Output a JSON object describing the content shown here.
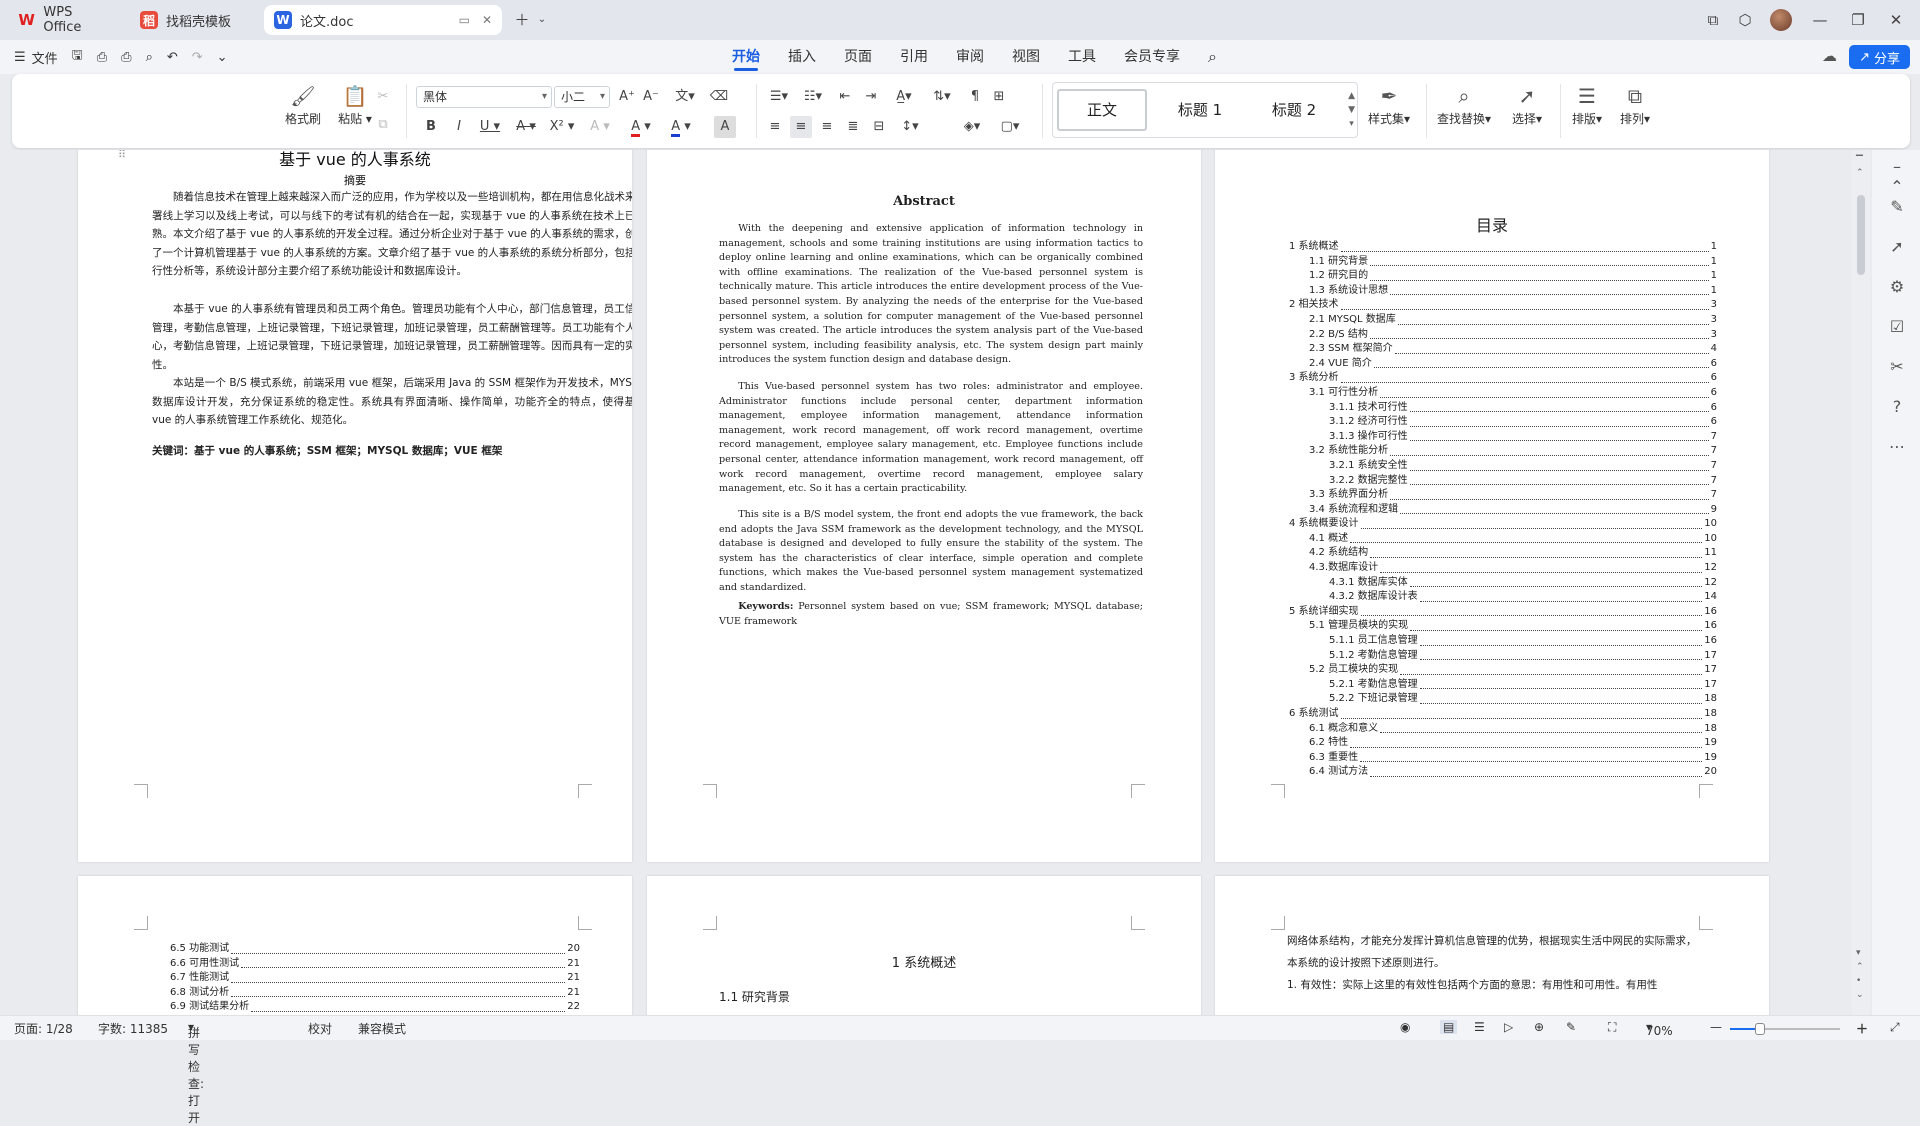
{
  "tabs": [
    {
      "label": "WPS Office",
      "icon": "wps-logo-icon"
    },
    {
      "label": "找稻壳模板",
      "icon": "docer-icon"
    },
    {
      "label": "论文.doc",
      "icon": "word-doc-icon"
    }
  ],
  "menu": {
    "file": "文件"
  },
  "ribbon_tabs": [
    "开始",
    "插入",
    "页面",
    "引用",
    "审阅",
    "视图",
    "工具",
    "会员专享"
  ],
  "share": "分享",
  "toolbar": {
    "format_painter": "格式刷",
    "paste": "粘贴",
    "font_name": "黑体",
    "font_size": "小二",
    "styles": [
      "正文",
      "标题 1",
      "标题 2"
    ],
    "styles_set": "样式集",
    "find_replace": "查找替换",
    "select": "选择",
    "layout": "排版",
    "arrange": "排列"
  },
  "page1": {
    "title": "基于 vue 的人事系统",
    "abstract_heading": "摘要",
    "paragraphs": [
      "随着信息技术在管理上越来越深入而广泛的应用，作为学校以及一些培训机构，都在用信息化战术来部署线上学习以及线上考试，可以与线下的考试有机的结合在一起，实现基于 vue 的人事系统在技术上已成熟。本文介绍了基于 vue 的人事系统的开发全过程。通过分析企业对于基于 vue 的人事系统的需求，创建了一个计算机管理基于 vue 的人事系统的方案。文章介绍了基于 vue 的人事系统的系统分析部分，包括可行性分析等，系统设计部分主要介绍了系统功能设计和数据库设计。",
      "本基于 vue 的人事系统有管理员和员工两个角色。管理员功能有个人中心，部门信息管理，员工信息管理，考勤信息管理，上班记录管理，下班记录管理，加班记录管理，员工薪酬管理等。员工功能有个人中心，考勤信息管理，上班记录管理，下班记录管理，加班记录管理，员工薪酬管理等。因而具有一定的实用性。",
      "本站是一个 B/S 模式系统，前端采用 vue 框架，后端采用 Java 的 SSM 框架作为开发技术，MYSQL 数据库设计开发，充分保证系统的稳定性。系统具有界面清晰、操作简单，功能齐全的特点，使得基于 vue 的人事系统管理工作系统化、规范化。"
    ],
    "keywords": "关键词：基于 vue 的人事系统；SSM 框架；MYSQL 数据库；VUE 框架"
  },
  "page2": {
    "title": "Abstract",
    "paragraphs": [
      "With the deepening and extensive application of information technology in management, schools and some training institutions are using information tactics to deploy online learning and online examinations, which can be organically combined with offline examinations. The realization of the Vue-based personnel system is technically mature. This article introduces the entire development process of the Vue-based personnel system. By analyzing the needs of the enterprise for the Vue-based personnel system, a solution for computer management of the Vue-based personnel system was created. The article introduces the system analysis part of the Vue-based personnel system, including feasibility analysis, etc. The system design part mainly introduces the system function design and database design.",
      "This Vue-based personnel system has two roles: administrator and employee. Administrator functions include personal center, department information management, employee information management, attendance information management, work record management, off work record management, overtime record management, employee salary management, etc. Employee functions include personal center, attendance information management, work record management, off work record management, overtime record management, employee salary management, etc. So it has a certain practicability.",
      "This site is a B/S model system, the front end adopts the vue framework, the back end adopts the Java SSM framework as the development technology, and the MYSQL database is designed and developed to fully ensure the stability of the system. The system has the characteristics of clear interface, simple operation and complete functions, which makes the Vue-based personnel system management systematized and standardized."
    ],
    "keywords_label": "Keywords:",
    "keywords": "Personnel system based on vue; SSM framework; MYSQL database; VUE framework"
  },
  "page3": {
    "title": "目录",
    "toc": [
      {
        "t": "1 系统概述",
        "p": "1",
        "l": 0
      },
      {
        "t": "1.1 研究背景",
        "p": "1",
        "l": 1
      },
      {
        "t": "1.2 研究目的",
        "p": "1",
        "l": 1
      },
      {
        "t": "1.3 系统设计思想",
        "p": "1",
        "l": 1
      },
      {
        "t": "2 相关技术",
        "p": "3",
        "l": 0
      },
      {
        "t": "2.1 MYSQL 数据库",
        "p": "3",
        "l": 1
      },
      {
        "t": "2.2 B/S 结构",
        "p": "3",
        "l": 1
      },
      {
        "t": "2.3 SSM 框架简介",
        "p": "4",
        "l": 1
      },
      {
        "t": "2.4 VUE 简介",
        "p": "6",
        "l": 1
      },
      {
        "t": "3 系统分析",
        "p": "6",
        "l": 0
      },
      {
        "t": "3.1 可行性分析",
        "p": "6",
        "l": 1
      },
      {
        "t": "3.1.1 技术可行性",
        "p": "6",
        "l": 2
      },
      {
        "t": "3.1.2 经济可行性",
        "p": "6",
        "l": 2
      },
      {
        "t": "3.1.3 操作可行性",
        "p": "7",
        "l": 2
      },
      {
        "t": "3.2 系统性能分析",
        "p": "7",
        "l": 1
      },
      {
        "t": "3.2.1 系统安全性",
        "p": "7",
        "l": 2
      },
      {
        "t": "3.2.2 数据完整性",
        "p": "7",
        "l": 2
      },
      {
        "t": "3.3 系统界面分析",
        "p": "7",
        "l": 1
      },
      {
        "t": "3.4 系统流程和逻辑",
        "p": "9",
        "l": 1
      },
      {
        "t": "4 系统概要设计",
        "p": "10",
        "l": 0
      },
      {
        "t": "4.1 概述",
        "p": "10",
        "l": 1
      },
      {
        "t": "4.2 系统结构",
        "p": "11",
        "l": 1
      },
      {
        "t": "4.3.数据库设计",
        "p": "12",
        "l": 1
      },
      {
        "t": "4.3.1 数据库实体",
        "p": "12",
        "l": 2
      },
      {
        "t": "4.3.2 数据库设计表",
        "p": "14",
        "l": 2
      },
      {
        "t": "5 系统详细实现",
        "p": "16",
        "l": 0
      },
      {
        "t": "5.1 管理员模块的实现",
        "p": "16",
        "l": 1
      },
      {
        "t": "5.1.1 员工信息管理",
        "p": "16",
        "l": 2
      },
      {
        "t": "5.1.2 考勤信息管理",
        "p": "17",
        "l": 2
      },
      {
        "t": "5.2 员工模块的实现",
        "p": "17",
        "l": 1
      },
      {
        "t": "5.2.1 考勤信息管理",
        "p": "17",
        "l": 2
      },
      {
        "t": "5.2.2 下班记录管理",
        "p": "18",
        "l": 2
      },
      {
        "t": "6 系统测试",
        "p": "18",
        "l": 0
      },
      {
        "t": "6.1 概念和意义",
        "p": "18",
        "l": 1
      },
      {
        "t": "6.2 特性",
        "p": "19",
        "l": 1
      },
      {
        "t": "6.3 重要性",
        "p": "19",
        "l": 1
      },
      {
        "t": "6.4 测试方法",
        "p": "20",
        "l": 1
      }
    ]
  },
  "page4": {
    "toc": [
      {
        "t": "6.5 功能测试",
        "p": "20"
      },
      {
        "t": "6.6 可用性测试",
        "p": "21"
      },
      {
        "t": "6.7 性能测试",
        "p": "21"
      },
      {
        "t": "6.8 测试分析",
        "p": "21"
      },
      {
        "t": "6.9 测试结果分析",
        "p": "22"
      }
    ]
  },
  "page5": {
    "chapter": "1 系统概述",
    "section": "1.1  研究背景"
  },
  "page6": {
    "line1": "网络体系结构，才能充分发挥计算机信息管理的优势，根据现实生活中网民的实际需求，",
    "line2": "本系统的设计按照下述原则进行。",
    "line3": "1.      有效性：实际上这里的有效性包括两个方面的意思：有用性和可用性。有用性"
  },
  "status": {
    "page": "页面: 1/28",
    "words": "字数: 11385",
    "spell": "拼写检查: 打开",
    "proof": "校对",
    "compat": "兼容模式",
    "zoom": "70%"
  }
}
